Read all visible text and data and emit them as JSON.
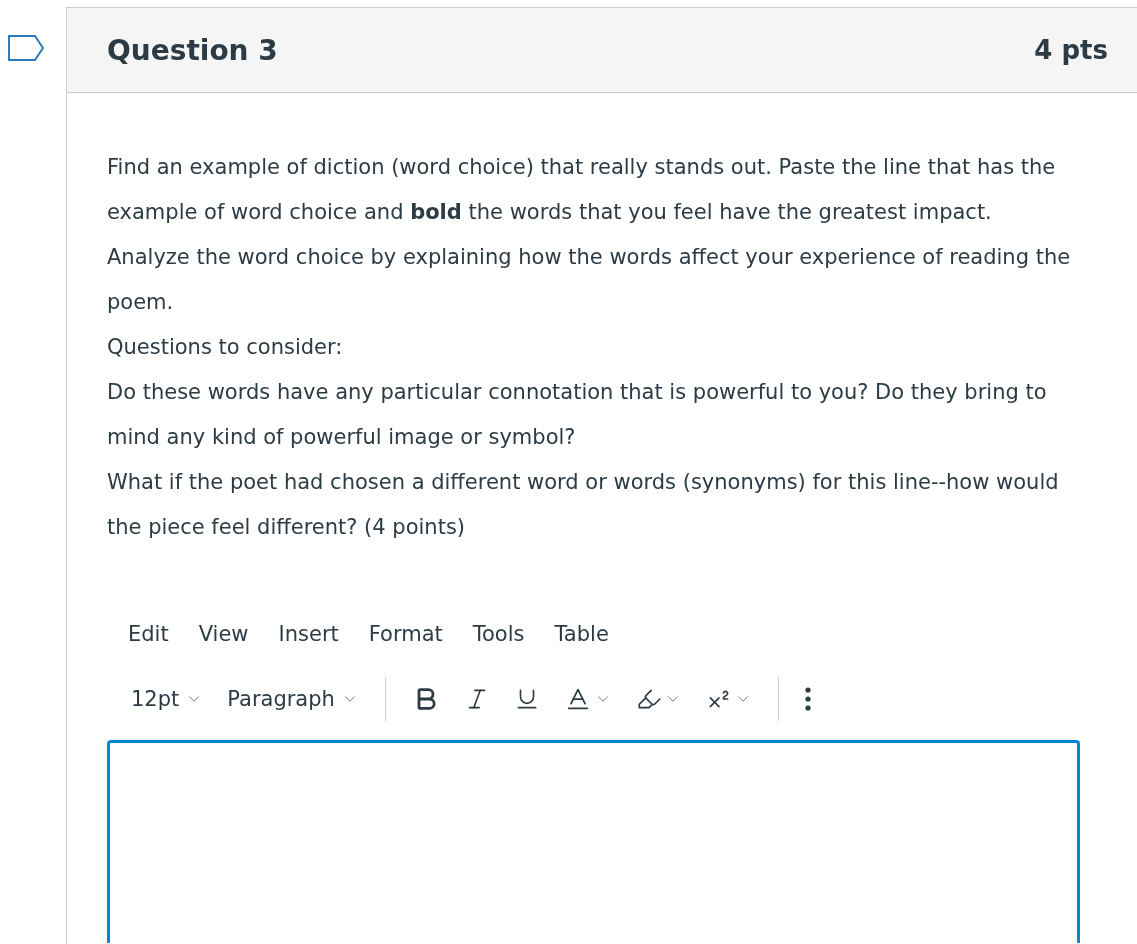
{
  "question": {
    "flagged": false,
    "title": "Question 3",
    "points": "4 pts",
    "paragraphs": [
      "Find an example of diction (word choice) that really stands out. Paste the line that has the example of word choice and **bold** the words that you feel have the greatest impact.",
      "Analyze the word choice by explaining how the words affect your experience of reading the poem.",
      "Questions to consider:",
      "Do these words have any particular connotation that is powerful to you? Do they bring to mind any kind of powerful image or symbol?",
      "What if the poet had chosen a different word or words (synonyms) for this line--how would the piece feel different? (4 points)"
    ]
  },
  "editor": {
    "menu": [
      "Edit",
      "View",
      "Insert",
      "Format",
      "Tools",
      "Table"
    ],
    "font_size": "12pt",
    "block_format": "Paragraph"
  }
}
